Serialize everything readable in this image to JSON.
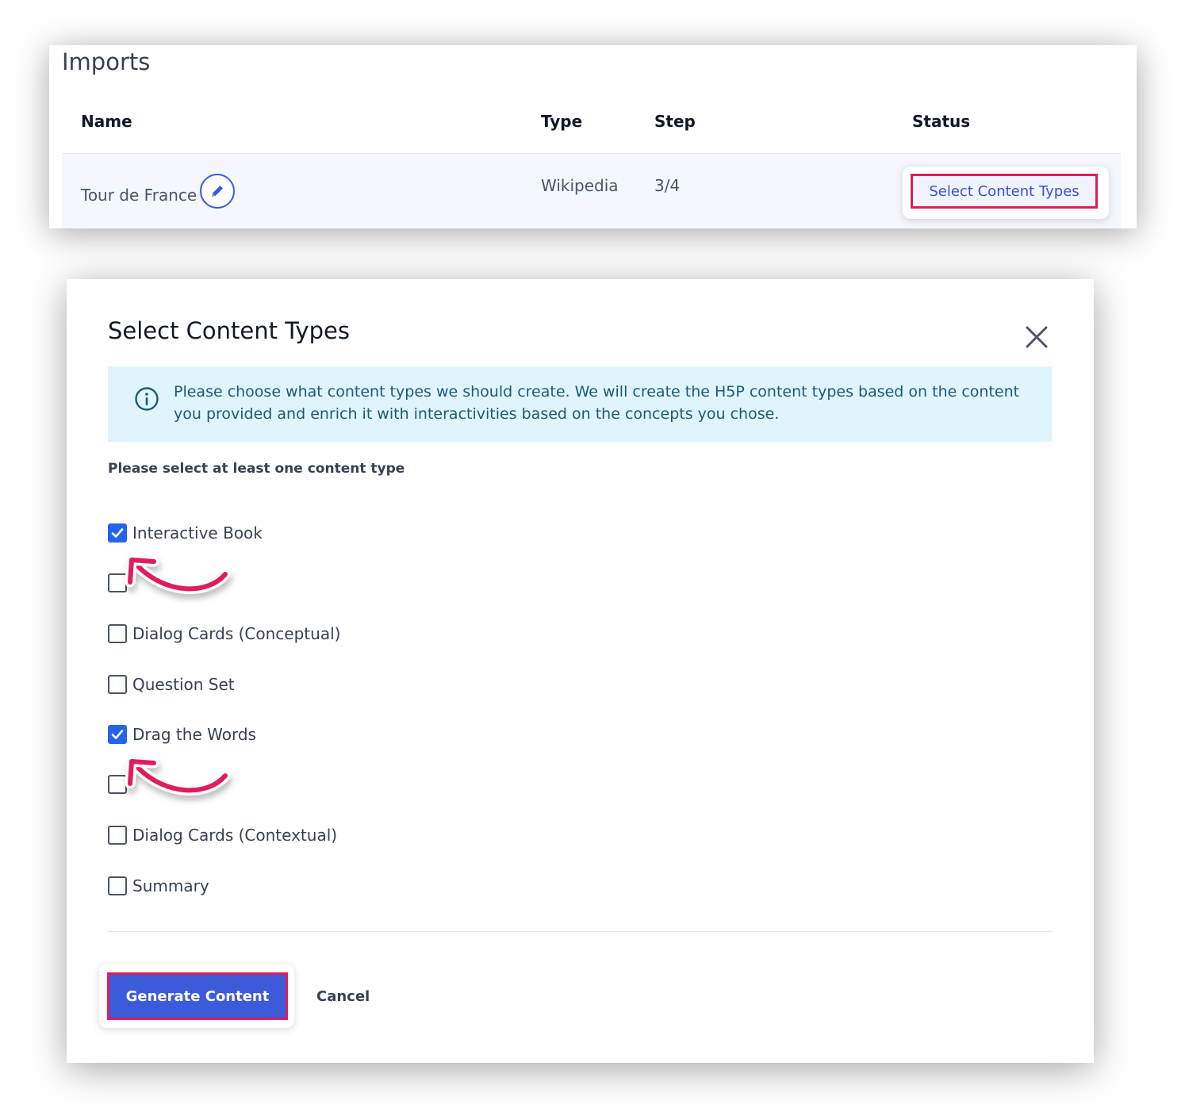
{
  "imports": {
    "title": "Imports",
    "columns": {
      "name": "Name",
      "type": "Type",
      "step": "Step",
      "status": "Status"
    },
    "row": {
      "name": "Tour de France",
      "type": "Wikipedia",
      "step": "3/4",
      "status_button": "Select Content Types"
    }
  },
  "modal": {
    "title": "Select Content Types",
    "info": "Please choose what content types we should create. We will create the H5P content types based on the content you provided and enrich it with interactivities based on the concepts you chose.",
    "hint": "Please select at least one content type",
    "options": [
      {
        "label": "Interactive Book",
        "checked": true
      },
      {
        "label": "",
        "checked": false
      },
      {
        "label": "Dialog Cards (Conceptual)",
        "checked": false
      },
      {
        "label": "Question Set",
        "checked": false
      },
      {
        "label": "Drag the Words",
        "checked": true
      },
      {
        "label": "",
        "checked": false
      },
      {
        "label": "Dialog Cards (Contextual)",
        "checked": false
      },
      {
        "label": "Summary",
        "checked": false
      }
    ],
    "generate_label": "Generate Content",
    "cancel_label": "Cancel"
  },
  "colors": {
    "accent": "#3b5bdb",
    "highlight": "#e11d5c",
    "info_bg": "#dff4fc"
  },
  "icons": [
    "pencil-icon",
    "close-icon",
    "info-icon",
    "check-icon",
    "curved-arrow-icon"
  ]
}
